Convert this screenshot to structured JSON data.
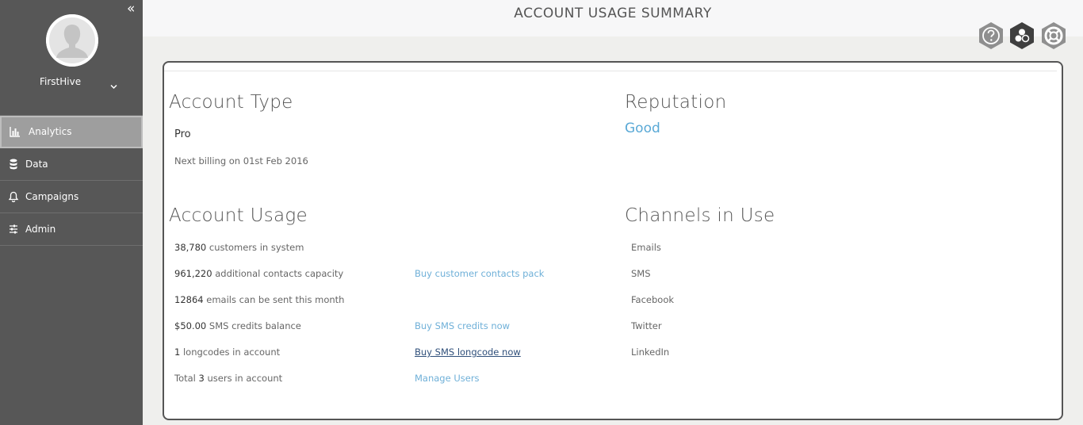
{
  "sidebar": {
    "collapse_icon": "double-chevron-left-icon",
    "user": {
      "name": "FirstHive"
    },
    "items": [
      {
        "label": "Analytics",
        "icon": "bar-chart-icon",
        "active": true
      },
      {
        "label": "Data",
        "icon": "database-icon",
        "active": false
      },
      {
        "label": "Campaigns",
        "icon": "bell-icon",
        "active": false
      },
      {
        "label": "Admin",
        "icon": "sliders-icon",
        "active": false
      }
    ]
  },
  "header": {
    "title": "ACCOUNT USAGE SUMMARY",
    "icons": [
      "help-icon",
      "apps-icon",
      "support-icon"
    ]
  },
  "account_type": {
    "title": "Account Type",
    "plan": "Pro",
    "billing": "Next billing on 01st Feb 2016"
  },
  "reputation": {
    "title": "Reputation",
    "value": "Good"
  },
  "usage": {
    "title": "Account Usage",
    "rows": [
      {
        "value": "38,780",
        "text": " customers in system",
        "link": ""
      },
      {
        "value": "961,220",
        "text": " additional contacts capacity",
        "link": "Buy customer contacts pack"
      },
      {
        "value": "12864",
        "text": " emails can be sent this month",
        "link": ""
      },
      {
        "value": "$50.00",
        "text": " SMS credits balance",
        "link": "Buy SMS credits now"
      },
      {
        "value": "1",
        "text": " longcodes in account",
        "link": "Buy SMS longcode now"
      },
      {
        "prefix": "Total ",
        "value": "3",
        "text": " users in account",
        "link": "Manage Users"
      }
    ]
  },
  "channels": {
    "title": "Channels in Use",
    "items": [
      "Emails",
      "SMS",
      "Facebook",
      "Twitter",
      "LinkedIn"
    ]
  },
  "colors": {
    "sidebar": "#575757",
    "active_item": "#9e9e9e",
    "accent": "#5aa9d6",
    "link_dark": "#2f4f7a"
  }
}
